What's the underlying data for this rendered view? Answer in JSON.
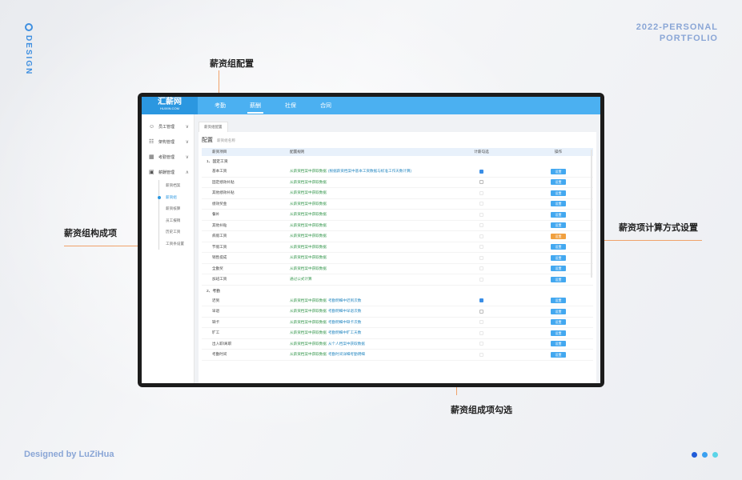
{
  "decor": {
    "brand_vertical": "DESIGN",
    "portfolio_line1": "2022-PERSONAL",
    "portfolio_line2": "PORTFOLIO",
    "signature": "Designed by LuZiHua",
    "dot_colors": [
      "#1f5bd8",
      "#3aa0f0",
      "#5ad4e8"
    ]
  },
  "annotations": {
    "top": "薪资组配置",
    "left": "薪资组构成项",
    "right": "薪资项计算方式设置",
    "bottom": "薪资组成项勾选",
    "accent_color": "#ef8a3c"
  },
  "app": {
    "logo": "汇薪网",
    "logo_sub": "HUIXIN.COM",
    "nav": [
      {
        "label": "考勤",
        "active": false
      },
      {
        "label": "薪酬",
        "active": true
      },
      {
        "label": "社保",
        "active": false
      },
      {
        "label": "合同",
        "active": false
      }
    ],
    "sidebar": {
      "groups": [
        {
          "label": "员工管理",
          "icon": "user-icon"
        },
        {
          "label": "架构管理",
          "icon": "org-icon"
        },
        {
          "label": "考勤管理",
          "icon": "calendar-icon"
        },
        {
          "label": "薪酬管理",
          "icon": "wallet-icon"
        }
      ],
      "subitems": [
        {
          "label": "薪资档案",
          "active": false
        },
        {
          "label": "薪资组",
          "active": true
        },
        {
          "label": "薪资核算",
          "active": false
        },
        {
          "label": "员工报销",
          "active": false
        },
        {
          "label": "历史工资",
          "active": false
        },
        {
          "label": "工资条设置",
          "active": false
        }
      ]
    },
    "breadcrumb": "薪资组配置",
    "panel_title": "配置",
    "panel_subtitle": "薪资组名称",
    "table_headers": [
      "薪资项目",
      "配置规则",
      "计薪勾选",
      "操作"
    ],
    "sections": [
      {
        "title": "1、固定工资",
        "rows": [
          {
            "item": "基本工资",
            "rule": "从薪资档案中获取数据",
            "hint": "(根据薪资档案中基本工资数据与标准工作天数计算)",
            "checked": "on"
          },
          {
            "item": "固定绩效补贴",
            "rule": "从薪资档案中获取数据",
            "hint": "",
            "checked": "box"
          },
          {
            "item": "其他绩效补贴",
            "rule": "从薪资档案中获取数据",
            "hint": "",
            "checked": "off"
          },
          {
            "item": "绩效奖金",
            "rule": "从薪资档案中获取数据",
            "hint": "",
            "checked": "off"
          },
          {
            "item": "餐补",
            "rule": "从薪资档案中获取数据",
            "hint": "",
            "checked": "off"
          },
          {
            "item": "其他补贴",
            "rule": "从薪资档案中获取数据",
            "hint": "",
            "checked": "off"
          },
          {
            "item": "病假工资",
            "rule": "从薪资档案中获取数据",
            "hint": "",
            "checked": "off"
          },
          {
            "item": "节假工资",
            "rule": "从薪资档案中获取数据",
            "hint": "",
            "checked": "off"
          },
          {
            "item": "销售提成",
            "rule": "从薪资档案中获取数据",
            "hint": "",
            "checked": "off"
          },
          {
            "item": "全勤奖",
            "rule": "从薪资档案中获取数据",
            "hint": "",
            "checked": "off"
          },
          {
            "item": "加班工资",
            "rule": "通过公式计算",
            "hint": "",
            "checked": "off"
          }
        ]
      },
      {
        "title": "2、考勤",
        "rows": [
          {
            "item": "迟到",
            "rule": "从薪资档案中获取数据",
            "hint": "考勤明细中迟到次数",
            "checked": "on"
          },
          {
            "item": "早退",
            "rule": "从薪资档案中获取数据",
            "hint": "考勤明细中早退次数",
            "checked": "box"
          },
          {
            "item": "缺卡",
            "rule": "从薪资档案中获取数据",
            "hint": "考勤明细中缺卡次数",
            "checked": "off"
          },
          {
            "item": "旷工",
            "rule": "从薪资档案中获取数据",
            "hint": "考勤明细中旷工天数",
            "checked": "off"
          },
          {
            "item": "出入职/离职",
            "rule": "从薪资档案中获取数据",
            "hint": "从个人档案中获取数据",
            "checked": "off"
          },
          {
            "item": "考勤时间",
            "rule": "从薪资档案中获取数据",
            "hint": "考勤时间详细考勤明细",
            "checked": "off"
          }
        ]
      }
    ],
    "btn_label": "设置"
  }
}
